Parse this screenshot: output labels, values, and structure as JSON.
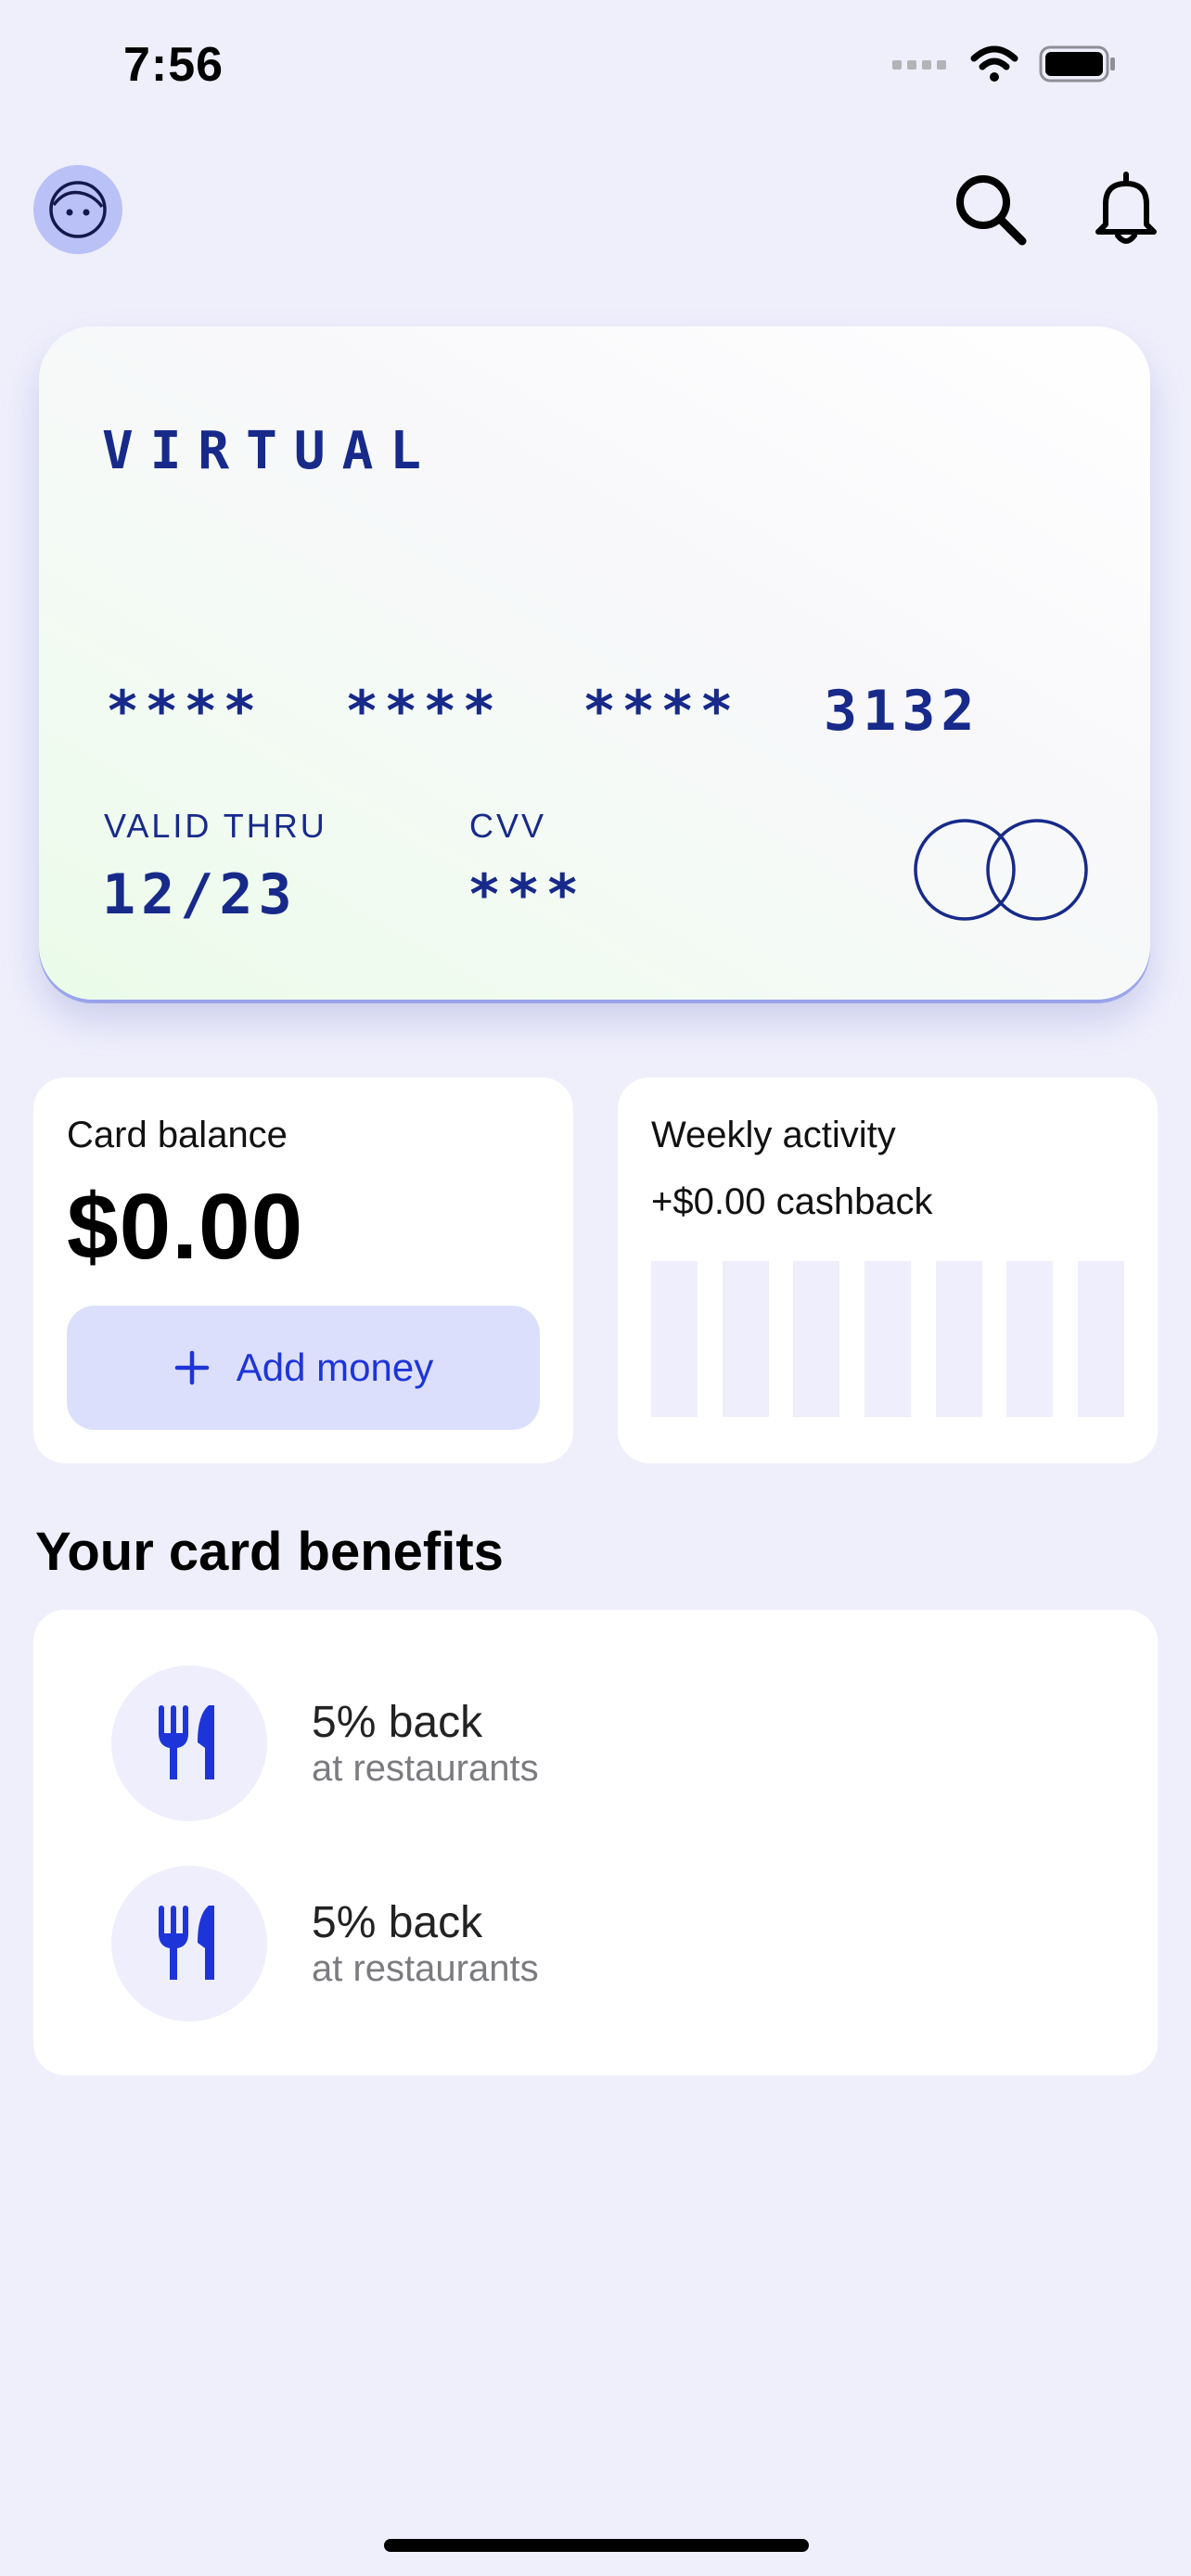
{
  "status_bar": {
    "time": "7:56"
  },
  "card": {
    "type_label": "VIRTUAL",
    "number_groups": [
      "****",
      "****",
      "****",
      "3132"
    ],
    "valid_thru_label": "VALID THRU",
    "valid_thru_value": "12/23",
    "cvv_label": "CVV",
    "cvv_value": "***",
    "network_icon": "mastercard-circles-icon"
  },
  "balance": {
    "label": "Card balance",
    "amount": "$0.00",
    "add_money_label": "Add money"
  },
  "weekly": {
    "label": "Weekly activity",
    "cashback": "+$0.00 cashback",
    "bar_values": [
      0,
      0,
      0,
      0,
      0,
      0,
      0
    ]
  },
  "benefits": {
    "title": "Your card benefits",
    "items": [
      {
        "icon": "fork-knife-icon",
        "title": "5% back",
        "subtitle": "at restaurants"
      },
      {
        "icon": "fork-knife-icon",
        "title": "5% back",
        "subtitle": "at restaurants"
      }
    ]
  },
  "colors": {
    "background": "#efeffc",
    "accent": "#1d35d8",
    "card_text": "#172a8a",
    "avatar_bg": "#b9c1f7"
  }
}
